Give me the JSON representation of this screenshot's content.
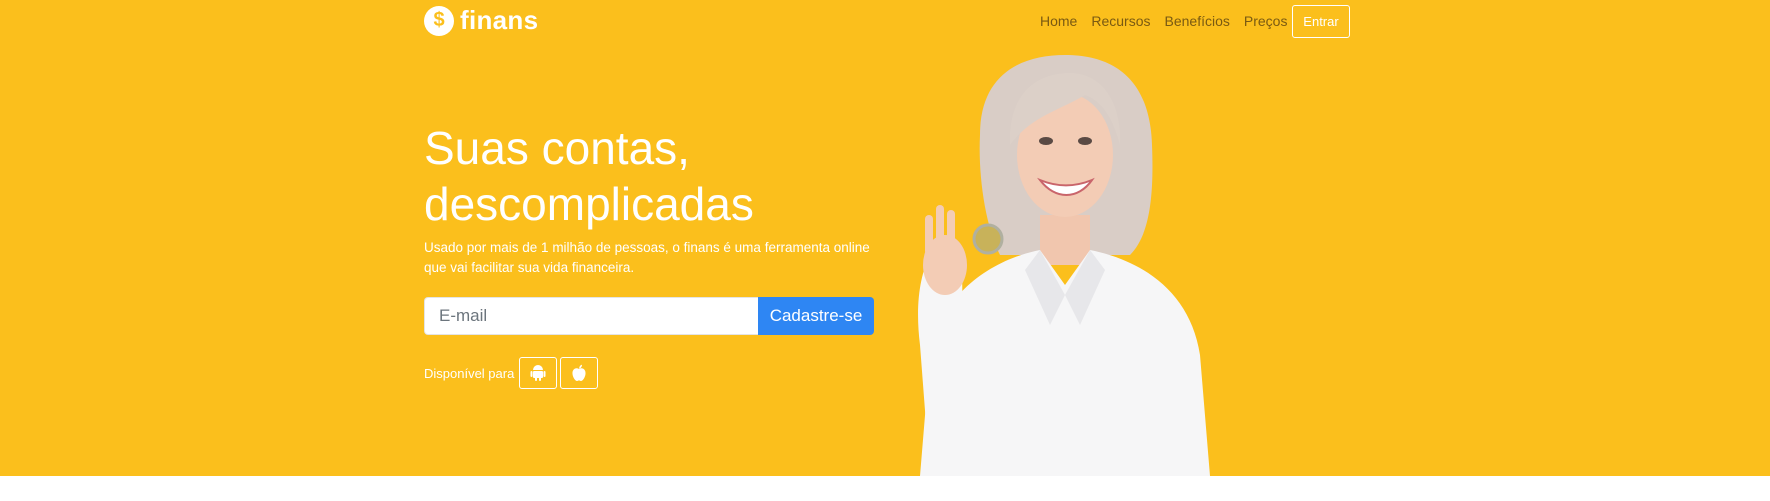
{
  "brand": {
    "name": "finans",
    "coin_symbol": "$"
  },
  "nav": {
    "items": [
      "Home",
      "Recursos",
      "Benefícios",
      "Preços"
    ],
    "login_label": "Entrar"
  },
  "hero": {
    "title_line1": "Suas contas,",
    "title_line2": "descomplicadas",
    "subtitle": "Usado por mais de 1 milhão de pessoas, o finans é uma ferramenta online que vai facilitar sua vida financeira.",
    "email_placeholder": "E-mail",
    "signup_label": "Cadastre-se",
    "available_label": "Disponível para",
    "platforms": [
      "android-icon",
      "apple-icon"
    ]
  },
  "colors": {
    "background": "#fbbf1c",
    "primary_button": "#2e86f3",
    "nav_text": "#7a5a12"
  }
}
